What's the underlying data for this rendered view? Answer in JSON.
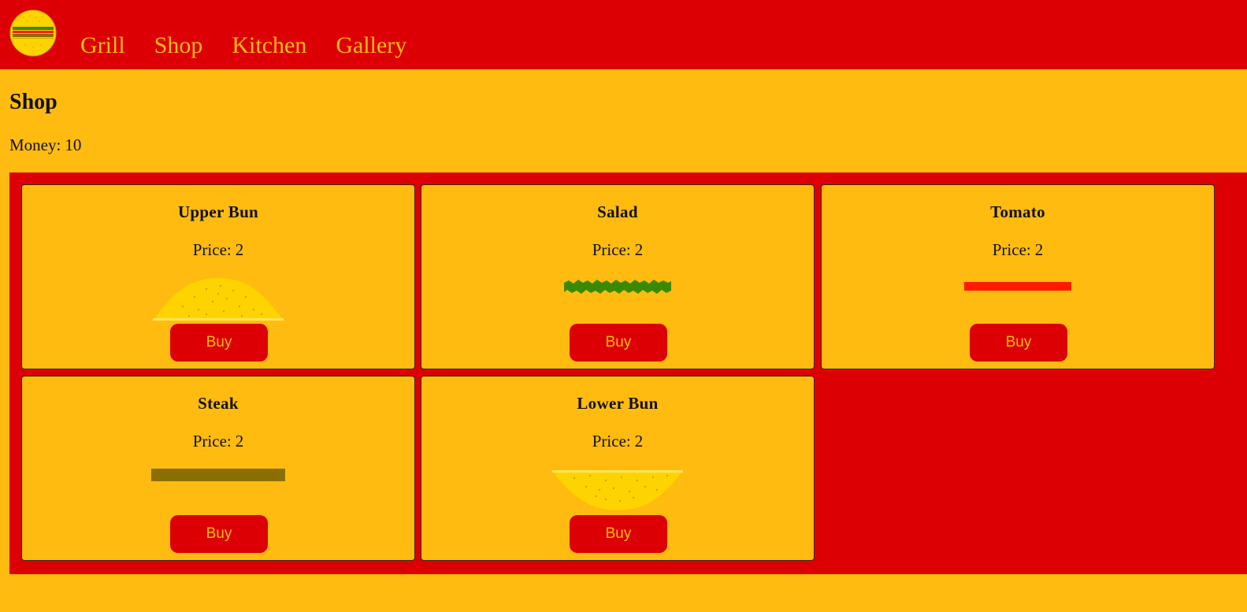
{
  "colors": {
    "primary_red": "#dc0005",
    "accent_yellow": "#ffbb10",
    "bun": "#fdd300",
    "salad": "#3a8a00",
    "tomato": "#ff1a00",
    "steak": "#8a6e00"
  },
  "nav": {
    "logo_icon": "burger-logo-icon",
    "links": [
      "Grill",
      "Shop",
      "Kitchen",
      "Gallery"
    ]
  },
  "page": {
    "title": "Shop",
    "money_label": "Money:",
    "money_value": "10"
  },
  "shop": {
    "price_label": "Price:",
    "items": [
      {
        "name": "Upper Bun",
        "price": "2",
        "icon": "upper-bun-icon",
        "buy_label": "Buy"
      },
      {
        "name": "Salad",
        "price": "2",
        "icon": "salad-icon",
        "buy_label": "Buy"
      },
      {
        "name": "Tomato",
        "price": "2",
        "icon": "tomato-icon",
        "buy_label": "Buy"
      },
      {
        "name": "Steak",
        "price": "2",
        "icon": "steak-icon",
        "buy_label": "Buy"
      },
      {
        "name": "Lower Bun",
        "price": "2",
        "icon": "lower-bun-icon",
        "buy_label": "Buy"
      }
    ]
  }
}
